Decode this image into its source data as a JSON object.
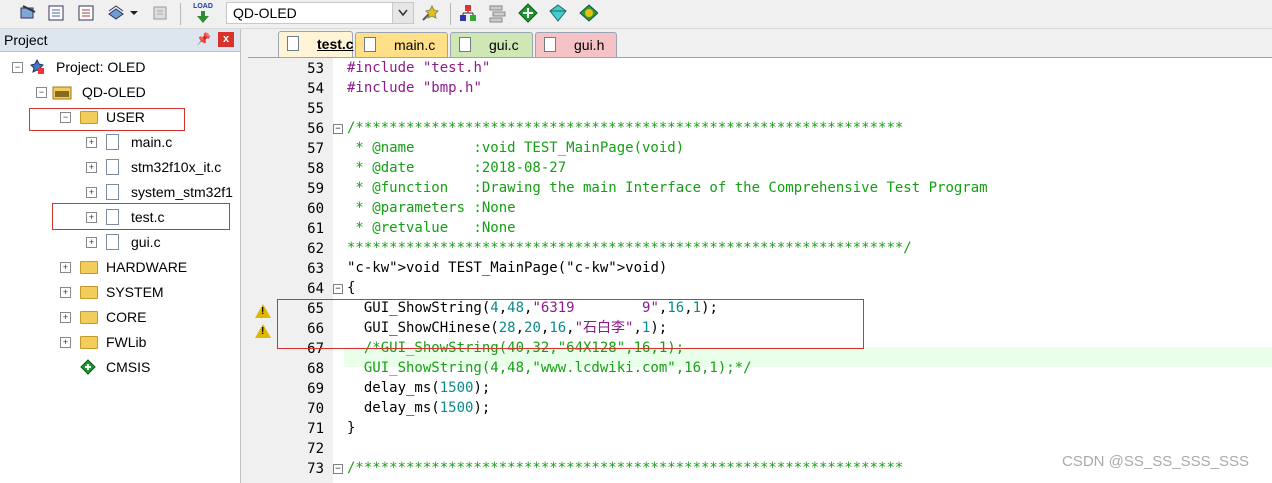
{
  "toolbar": {
    "target": "QD-OLED",
    "icons": [
      "translate-icon",
      "build-icon",
      "rebuild-icon",
      "batch-build-icon",
      "dropdown-arrow-icon",
      "stop-build-icon",
      "download-icon",
      "target-options-icon",
      "manage-project-icon",
      "select-packs-icon",
      "pack-installer-icon",
      "manage-rte-icon",
      "manage-components-icon"
    ],
    "load_label": "LOAD"
  },
  "project_panel": {
    "title": "Project",
    "pin": "ᵽ",
    "close": "x",
    "tree": {
      "project": "Project: OLED",
      "target": "QD-OLED",
      "groups": [
        {
          "name": "USER",
          "files": [
            "main.c",
            "stm32f10x_it.c",
            "system_stm32f1",
            "test.c",
            "gui.c"
          ]
        },
        {
          "name": "HARDWARE"
        },
        {
          "name": "SYSTEM"
        },
        {
          "name": "CORE"
        },
        {
          "name": "FWLib"
        },
        {
          "name": "CMSIS"
        }
      ]
    }
  },
  "tabs": [
    {
      "label": "test.c",
      "color": "#fff5d6",
      "active": true
    },
    {
      "label": "main.c",
      "color": "#ffe089"
    },
    {
      "label": "gui.c",
      "color": "#cfe7b5"
    },
    {
      "label": "gui.h",
      "color": "#f5c2c5"
    }
  ],
  "code": {
    "lines": [
      {
        "n": "53",
        "text": "#include \"test.h\""
      },
      {
        "n": "54",
        "text": "#include \"bmp.h\""
      },
      {
        "n": "55",
        "text": ""
      },
      {
        "n": "56",
        "text": "/*****************************************************************"
      },
      {
        "n": "57",
        "text": " * @name       :void TEST_MainPage(void)"
      },
      {
        "n": "58",
        "text": " * @date       :2018-08-27"
      },
      {
        "n": "59",
        "text": " * @function   :Drawing the main Interface of the Comprehensive Test Program"
      },
      {
        "n": "60",
        "text": " * @parameters :None"
      },
      {
        "n": "61",
        "text": " * @retvalue   :None"
      },
      {
        "n": "62",
        "text": "******************************************************************/"
      },
      {
        "n": "63",
        "text": "void TEST_MainPage(void)"
      },
      {
        "n": "64",
        "text": "{"
      },
      {
        "n": "65",
        "text": "  GUI_ShowString(4,48,\"6319        9\",16,1);"
      },
      {
        "n": "66",
        "text": "  GUI_ShowCHinese(28,20,16,\"石白李\",1);"
      },
      {
        "n": "67",
        "text": "  /*GUI_ShowString(40,32,\"64X128\",16,1);"
      },
      {
        "n": "68",
        "text": "  GUI_ShowString(4,48,\"www.lcdwiki.com\",16,1);*/"
      },
      {
        "n": "69",
        "text": "  delay_ms(1500);"
      },
      {
        "n": "70",
        "text": "  delay_ms(1500);"
      },
      {
        "n": "71",
        "text": "}"
      },
      {
        "n": "72",
        "text": ""
      },
      {
        "n": "73",
        "text": "/*****************************************************************"
      }
    ]
  },
  "watermark": "CSDN @SS_SS_SSS_SSS"
}
